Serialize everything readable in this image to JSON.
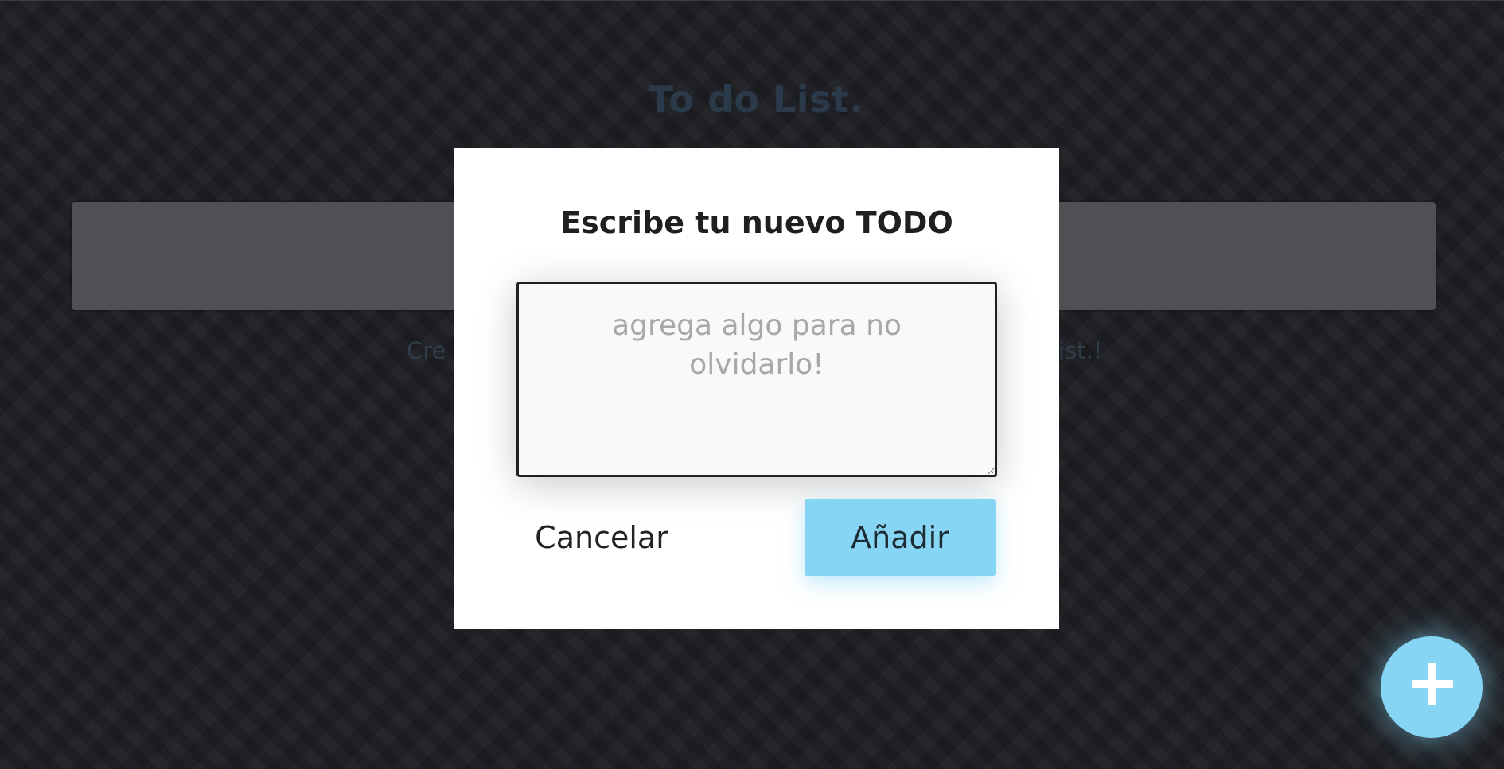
{
  "header": {
    "title": "To do List."
  },
  "search": {
    "placeholder": ""
  },
  "list": {
    "empty_message_left": "Cre",
    "empty_message_right": "list.!"
  },
  "modal": {
    "title": "Escribe tu nuevo TODO",
    "textarea_placeholder": "agrega algo para no olvidarlo!",
    "textarea_value": "",
    "cancel_label": "Cancelar",
    "add_label": "Añadir"
  },
  "fab": {
    "icon": "plus-icon"
  },
  "colors": {
    "background": "#1d1e23",
    "accent": "#86d5f5",
    "title": "#2b3a4a",
    "modal_bg": "#ffffff"
  }
}
